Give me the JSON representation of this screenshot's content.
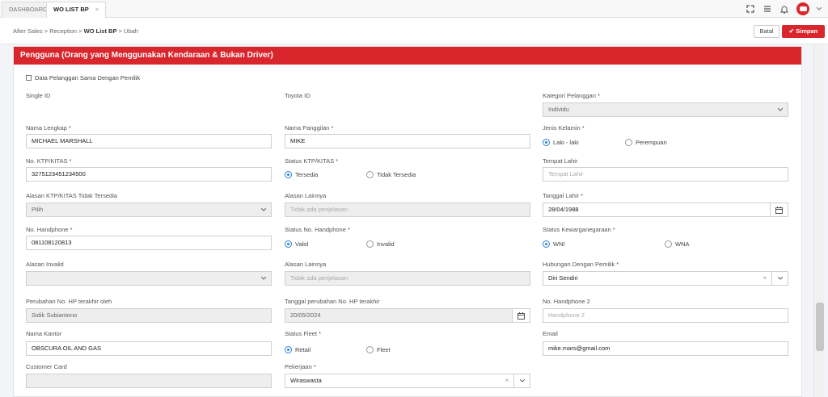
{
  "tabs": [
    {
      "label": "DASHBOARD"
    },
    {
      "label": "WO LIST BP",
      "close": "×"
    }
  ],
  "icons": {
    "expand": "expand-icon",
    "menu": "menu-icon",
    "bell": "bell-icon",
    "avatar": "avatar",
    "caret": "chevron-down-icon"
  },
  "breadcrumb": {
    "root": "After Sales",
    "sep": ">",
    "level2": "Reception",
    "current": "WO List BP",
    "action": "Ubah"
  },
  "buttons": {
    "batal": "Batal",
    "simpan": "Simpan"
  },
  "section": {
    "title": "Pengguna (Orang yang Menggunakan Kendaraan & Bukan Driver)"
  },
  "checkbox": {
    "label": "Data Pelanggan Sama Dengan Pemilik",
    "checked": false
  },
  "fields": {
    "single_id": {
      "label": "Single ID"
    },
    "toyota_id": {
      "label": "Toyota ID"
    },
    "kategori": {
      "label": "Kategori Pelanggan *",
      "value": "Individu"
    },
    "nama_lengkap": {
      "label": "Nama Lengkap *",
      "value": "MICHAEL MARSHALL"
    },
    "nama_panggilan": {
      "label": "Nama Panggilan *",
      "value": "MIKE"
    },
    "jenis_kelamin": {
      "label": "Jenis Kelamin *",
      "options": [
        "Laki - laki",
        "Perempuan"
      ],
      "selected": "Laki - laki"
    },
    "ktp": {
      "label": "No. KTP/KITAS *",
      "value": "3275123451234500"
    },
    "status_ktp": {
      "label": "Status KTP/KITAS *",
      "options": [
        "Tersedia",
        "Tidak Tersedia"
      ],
      "selected": "Tersedia"
    },
    "tempat_lahir": {
      "label": "Tempat Lahir",
      "placeholder": "Tempat Lahir"
    },
    "alasan_ktp": {
      "label": "Alasan KTP/KITAS Tidak Tersedia",
      "value": "Pilih"
    },
    "alasan_lainnya_1": {
      "label": "Alasan Lainnya",
      "placeholder": "Tidak ada penjelasan"
    },
    "tanggal_lahir": {
      "label": "Tanggal Lahir *",
      "value": "28/04/1988"
    },
    "handphone": {
      "label": "No. Handphone *",
      "value": "081108120813"
    },
    "status_hp": {
      "label": "Status No. Handphone *",
      "options": [
        "Valid",
        "Invalid"
      ],
      "selected": "Valid"
    },
    "kewarganegaraan": {
      "label": "Status Kewarganegaraan *",
      "options": [
        "WNI",
        "WNA"
      ],
      "selected": "WNI"
    },
    "alasan_invalid": {
      "label": "Alasan Invalid",
      "value": ""
    },
    "alasan_lainnya_2": {
      "label": "Alasan Lainnya",
      "placeholder": "Tidak ada penjelasan"
    },
    "hubungan": {
      "label": "Hubungan Dengan Pemilik *",
      "value": "Diri Sendiri",
      "clear": "×"
    },
    "perubahan_hp_oleh": {
      "label": "Perubahan No. HP terakhir oleh",
      "value": "Sidik Subiantono"
    },
    "tanggal_perubahan": {
      "label": "Tanggal perubahan No. HP terakhir",
      "value": "20/05/2024"
    },
    "handphone2": {
      "label": "No. Handphone 2",
      "placeholder": "Handphone 2"
    },
    "nama_kantor": {
      "label": "Nama Kantor",
      "value": "OBSCURA OIL AND GAS"
    },
    "status_fleet": {
      "label": "Status Fleet *",
      "options": [
        "Retail",
        "Fleet"
      ],
      "selected": "Retail"
    },
    "email": {
      "label": "Email",
      "value": "mike.mars@gmail.com"
    },
    "customer_card": {
      "label": "Customer Card",
      "value": ""
    },
    "pekerjaan": {
      "label": "Pekerjaan *",
      "value": "Wiraswasta",
      "clear": "×"
    }
  },
  "colors": {
    "accent": "#d9262c",
    "radio": "#2a7fd4"
  }
}
